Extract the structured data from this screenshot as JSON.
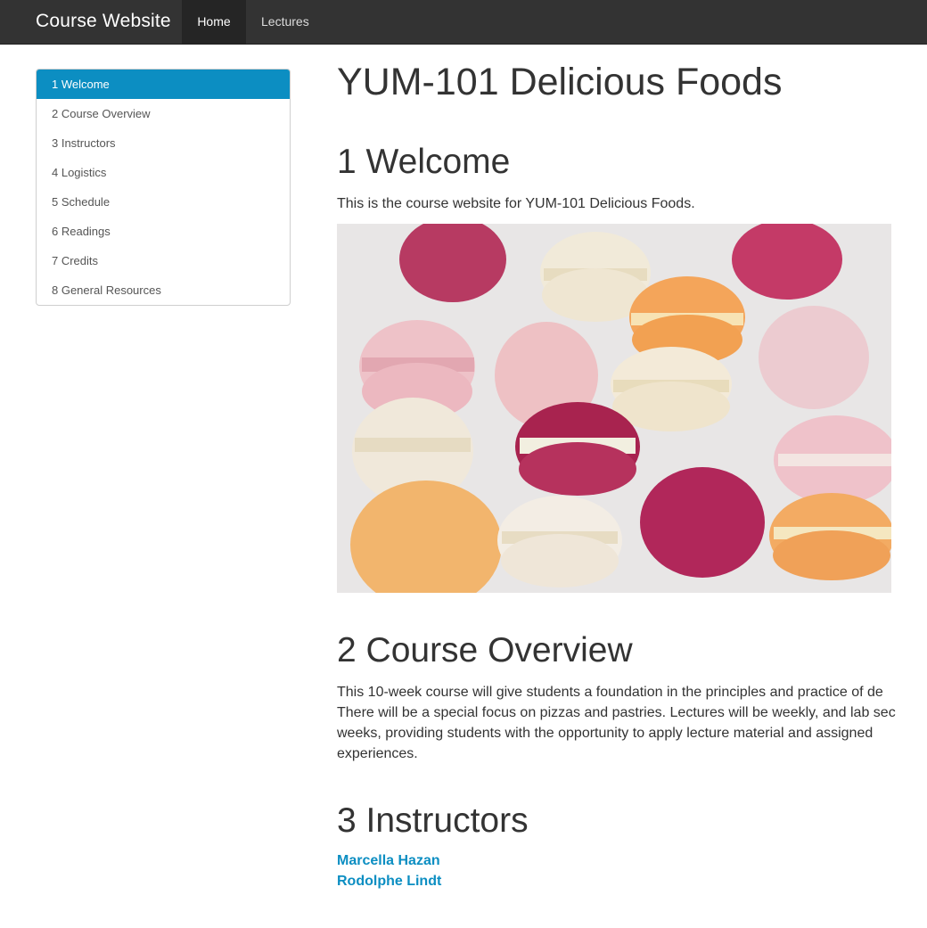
{
  "navbar": {
    "brand": "Course Website",
    "links": [
      {
        "label": "Home",
        "active": true
      },
      {
        "label": "Lectures",
        "active": false
      }
    ],
    "background": "#333333"
  },
  "toc": {
    "items": [
      {
        "label": "1 Welcome",
        "active": true
      },
      {
        "label": "2 Course Overview",
        "active": false
      },
      {
        "label": "3 Instructors",
        "active": false
      },
      {
        "label": "4 Logistics",
        "active": false
      },
      {
        "label": "5 Schedule",
        "active": false
      },
      {
        "label": "6 Readings",
        "active": false
      },
      {
        "label": "7 Credits",
        "active": false
      },
      {
        "label": "8 General Resources",
        "active": false
      }
    ],
    "active_color": "#0c8ec2"
  },
  "main": {
    "title": "YUM-101 Delicious Foods",
    "welcome": {
      "heading": "1 Welcome",
      "text": "This is the course website for YUM-101 Delicious Foods.",
      "image": "macarons-photo"
    },
    "overview": {
      "heading": "2 Course Overview",
      "lines": [
        "This 10-week course will give students a foundation in the principles and practice of de",
        "There will be a special focus on pizzas and pastries. Lectures will be weekly, and lab sec",
        "weeks, providing students with the opportunity to apply lecture material and assigned",
        "experiences."
      ]
    },
    "instructors": {
      "heading": "3 Instructors",
      "names": [
        "Marcella Hazan",
        "Rodolphe Lindt"
      ]
    }
  },
  "colors": {
    "link": "#0c8ec2",
    "text": "#333333"
  }
}
